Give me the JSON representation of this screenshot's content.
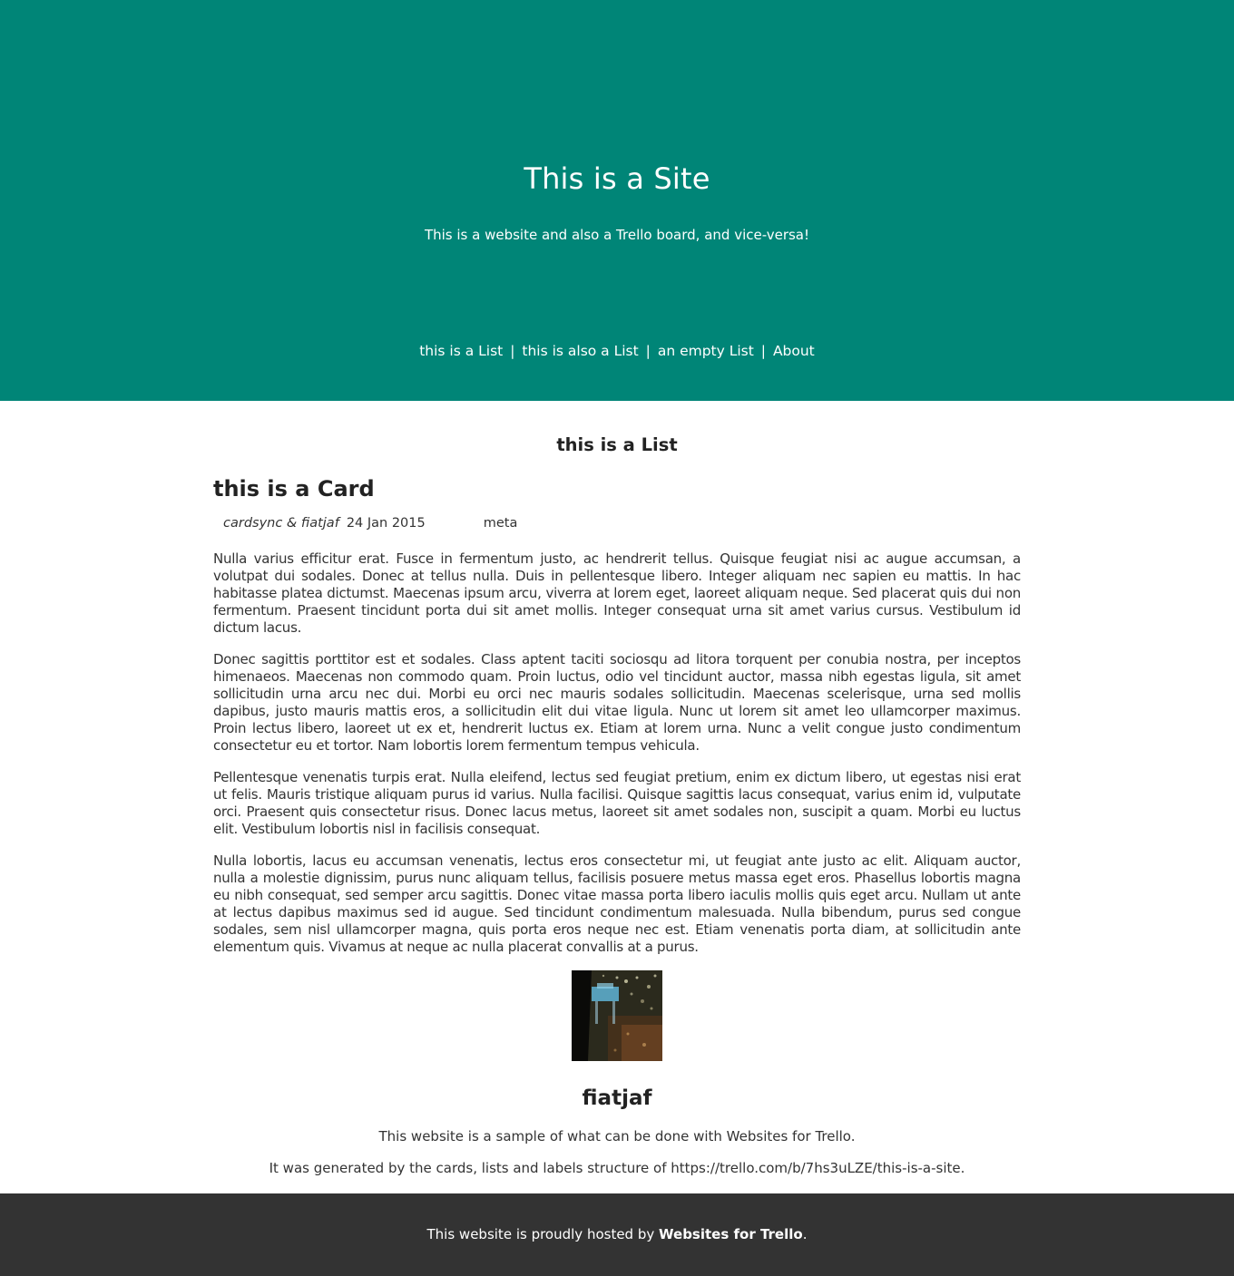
{
  "header": {
    "title": "This is a Site",
    "subtitle": "This is a website and also a Trello board, and vice-versa!",
    "nav": {
      "items": [
        "this is a List",
        "this is also a List",
        "an empty List",
        "About"
      ],
      "separator": "|"
    },
    "background_color": "#008577"
  },
  "list": {
    "title": "this is a List",
    "card": {
      "title": "this is a Card",
      "authors": "cardsync & fiatjaf",
      "date": "24 Jan 2015",
      "label": "meta",
      "paragraphs": [
        "Nulla varius efficitur erat. Fusce in fermentum justo, ac hendrerit tellus. Quisque feugiat nisi ac augue accumsan, a volutpat dui sodales. Donec at tellus nulla. Duis in pellentesque libero. Integer aliquam nec sapien eu mattis. In hac habitasse platea dictumst. Maecenas ipsum arcu, viverra at lorem eget, laoreet aliquam neque. Sed placerat quis dui non fermentum. Praesent tincidunt porta dui sit amet mollis. Integer consequat urna sit amet varius cursus. Vestibulum id dictum lacus.",
        "Donec sagittis porttitor est et sodales. Class aptent taciti sociosqu ad litora torquent per conubia nostra, per inceptos himenaeos. Maecenas non commodo quam. Proin luctus, odio vel tincidunt auctor, massa nibh egestas ligula, sit amet sollicitudin urna arcu nec dui. Morbi eu orci nec mauris sodales sollicitudin. Maecenas scelerisque, urna sed mollis dapibus, justo mauris mattis eros, a sollicitudin elit dui vitae ligula. Nunc ut lorem sit amet leo ullamcorper maximus. Proin lectus libero, laoreet ut ex et, hendrerit luctus ex. Etiam at lorem urna. Nunc a velit congue justo condimentum consectetur eu et tortor. Nam lobortis lorem fermentum tempus vehicula.",
        "Pellentesque venenatis turpis erat. Nulla eleifend, lectus sed feugiat pretium, enim ex dictum libero, ut egestas nisi erat ut felis. Mauris tristique aliquam purus id varius. Nulla facilisi. Quisque sagittis lacus consequat, varius enim id, vulputate orci. Praesent quis consectetur risus. Donec lacus metus, laoreet sit amet sodales non, suscipit a quam. Morbi eu luctus elit. Vestibulum lobortis nisl in facilisis consequat.",
        "Nulla lobortis, lacus eu accumsan venenatis, lectus eros consectetur mi, ut feugiat ante justo ac elit. Aliquam auctor, nulla a molestie dignissim, purus nunc aliquam tellus, facilisis posuere metus massa eget eros. Phasellus lobortis magna eu nibh consequat, sed semper arcu sagittis. Donec vitae massa porta libero iaculis mollis quis eget arcu. Nullam ut ante at lectus dapibus maximus sed id augue. Sed tincidunt condimentum malesuada. Nulla bibendum, purus sed congue sodales, sem nisl ullamcorper magna, quis porta eros neque nec est. Etiam venenatis porta diam, at sollicitudin ante elementum quis. Vivamus at neque ac nulla placerat convallis at a purus."
      ]
    }
  },
  "about": {
    "name": "fiatjaf",
    "line1": "This website is a sample of what can be done with Websites for Trello.",
    "line2": "It was generated by the cards, lists and labels structure of https://trello.com/b/7hs3uLZE/this-is-a-site."
  },
  "footer": {
    "prefix": "This website is proudly hosted by ",
    "link_text": "Websites for Trello",
    "suffix": ".",
    "background_color": "#333333"
  }
}
